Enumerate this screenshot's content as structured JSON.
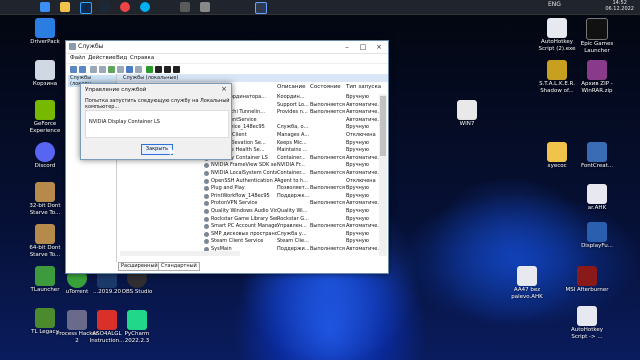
{
  "taskbar": {
    "lang": "ENG",
    "time": "14:52",
    "date": "06.12.2022",
    "icons": [
      "windows-start",
      "file-explorer",
      "photoshop",
      "steam",
      "chrome",
      "skype",
      "unknown-app",
      "settings",
      "search"
    ]
  },
  "desktop_left": [
    {
      "label": "DriverPack"
    },
    {
      "label": "Корзина"
    },
    {
      "label": "GeForce Experience"
    },
    {
      "label": "Discord"
    },
    {
      "label": "32-bit Dont Starve To..."
    },
    {
      "label": "64-bit Dont Starve To..."
    },
    {
      "label": "TLauncher"
    },
    {
      "label": "TL Legacy"
    }
  ],
  "desktop_bottom": [
    {
      "label": "uTorrent"
    },
    {
      "label": "...2019.20"
    },
    {
      "label": "OBS Studio"
    },
    {
      "label": "Process Hacker 2"
    },
    {
      "label": "ASO4ALGL Instruction..."
    },
    {
      "label": "PyCharm 2022.2.3"
    }
  ],
  "desktop_right": [
    {
      "label": "AutoHotkey Script (2).exe"
    },
    {
      "label": "Epic Games Launcher"
    },
    {
      "label": "S.T.A.L.K.E.R. Shadow of..."
    },
    {
      "label": "Архив ZIP - WinRAR.zip"
    },
    {
      "label": "WIN7"
    },
    {
      "label": "xyecoc"
    },
    {
      "label": "FontCreat..."
    },
    {
      "label": "ar.AHK"
    },
    {
      "label": "DisplayFu..."
    },
    {
      "label": "AA47 bez palevo.AHK"
    },
    {
      "label": "MSI Afterburner"
    },
    {
      "label": "AutoHotkey Script -> ..."
    }
  ],
  "services_window": {
    "title": "Службы",
    "menu": [
      "Файл",
      "Действие",
      "Вид",
      "Справка"
    ],
    "left_item": "Службы (локалы",
    "header_strip": "Службы (локальные)",
    "columns": [
      "Описание",
      "Состояние",
      "Тип запуска"
    ],
    "rows": [
      {
        "name": "...ия координатора...",
        "desc": "Координ...",
        "state": "",
        "type": "Вручную"
      },
      {
        "name": "...DirSvc",
        "desc": "Support Lo...",
        "state": "Выполняется",
        "type": "Автоматиче..."
      },
      {
        "name": "...Hamachi Tunnelin...",
        "desc": "Provides n...",
        "state": "Выполняется",
        "type": "Автоматиче..."
      },
      {
        "name": "...agementService",
        "desc": "",
        "state": "",
        "type": "Автоматиче..."
      },
      {
        "name": "...ngService_148ec95",
        "desc": "Служба, о...",
        "state": "",
        "type": "Вручную"
      },
      {
        "name": "...App-V Client",
        "desc": "Manages A...",
        "state": "",
        "type": "Отключена"
      },
      {
        "name": "...Edge Elevation Se...",
        "desc": "Keeps Mic...",
        "state": "",
        "type": "Вручную"
      },
      {
        "name": "...Update Health Se...",
        "desc": "Maintains ...",
        "state": "",
        "type": "Вручную"
      },
      {
        "name": "...Display Container LS",
        "desc": "Container...",
        "state": "Выполняется",
        "type": "Автоматиче..."
      },
      {
        "name": "NVIDIA FrameView SDK serv...",
        "desc": "NVIDIA Fr...",
        "state": "",
        "type": "Вручную"
      },
      {
        "name": "NVIDIA LocalSystem Container",
        "desc": "Container...",
        "state": "Выполняется",
        "type": "Автоматиче..."
      },
      {
        "name": "OpenSSH Authentication A...",
        "desc": "Agent to h...",
        "state": "",
        "type": "Отключена"
      },
      {
        "name": "Plug and Play",
        "desc": "Позволяет...",
        "state": "Выполняется",
        "type": "Вручную"
      },
      {
        "name": "PrintWorkflow_148ec95",
        "desc": "Поддержк...",
        "state": "",
        "type": "Вручную"
      },
      {
        "name": "ProtonVPN Service",
        "desc": "",
        "state": "Выполняется",
        "type": "Автоматиче..."
      },
      {
        "name": "Quality Windows Audio Vid...",
        "desc": "Quality Wi...",
        "state": "",
        "type": "Вручную"
      },
      {
        "name": "Rockstar Game Library Servi...",
        "desc": "Rockstar G...",
        "state": "",
        "type": "Вручную"
      },
      {
        "name": "Smart PC Account Manager",
        "desc": "Управлен...",
        "state": "Выполняется",
        "type": "Автоматиче..."
      },
      {
        "name": "SMP дисковых пространст...",
        "desc": "Служба у...",
        "state": "",
        "type": "Вручную"
      },
      {
        "name": "Steam Client Service",
        "desc": "Steam Clie...",
        "state": "",
        "type": "Вручную"
      },
      {
        "name": "SysMain",
        "desc": "Поддержи...",
        "state": "Выполняется",
        "type": "Автоматиче..."
      }
    ],
    "tabs": [
      "Расширенный",
      "Стандартный"
    ]
  },
  "dialog": {
    "title": "Управление службой",
    "message": "Попытка запустить следующую службу на Локальный компьютер...",
    "service": "NVIDIA Display Container LS",
    "button": "Закрыть"
  }
}
